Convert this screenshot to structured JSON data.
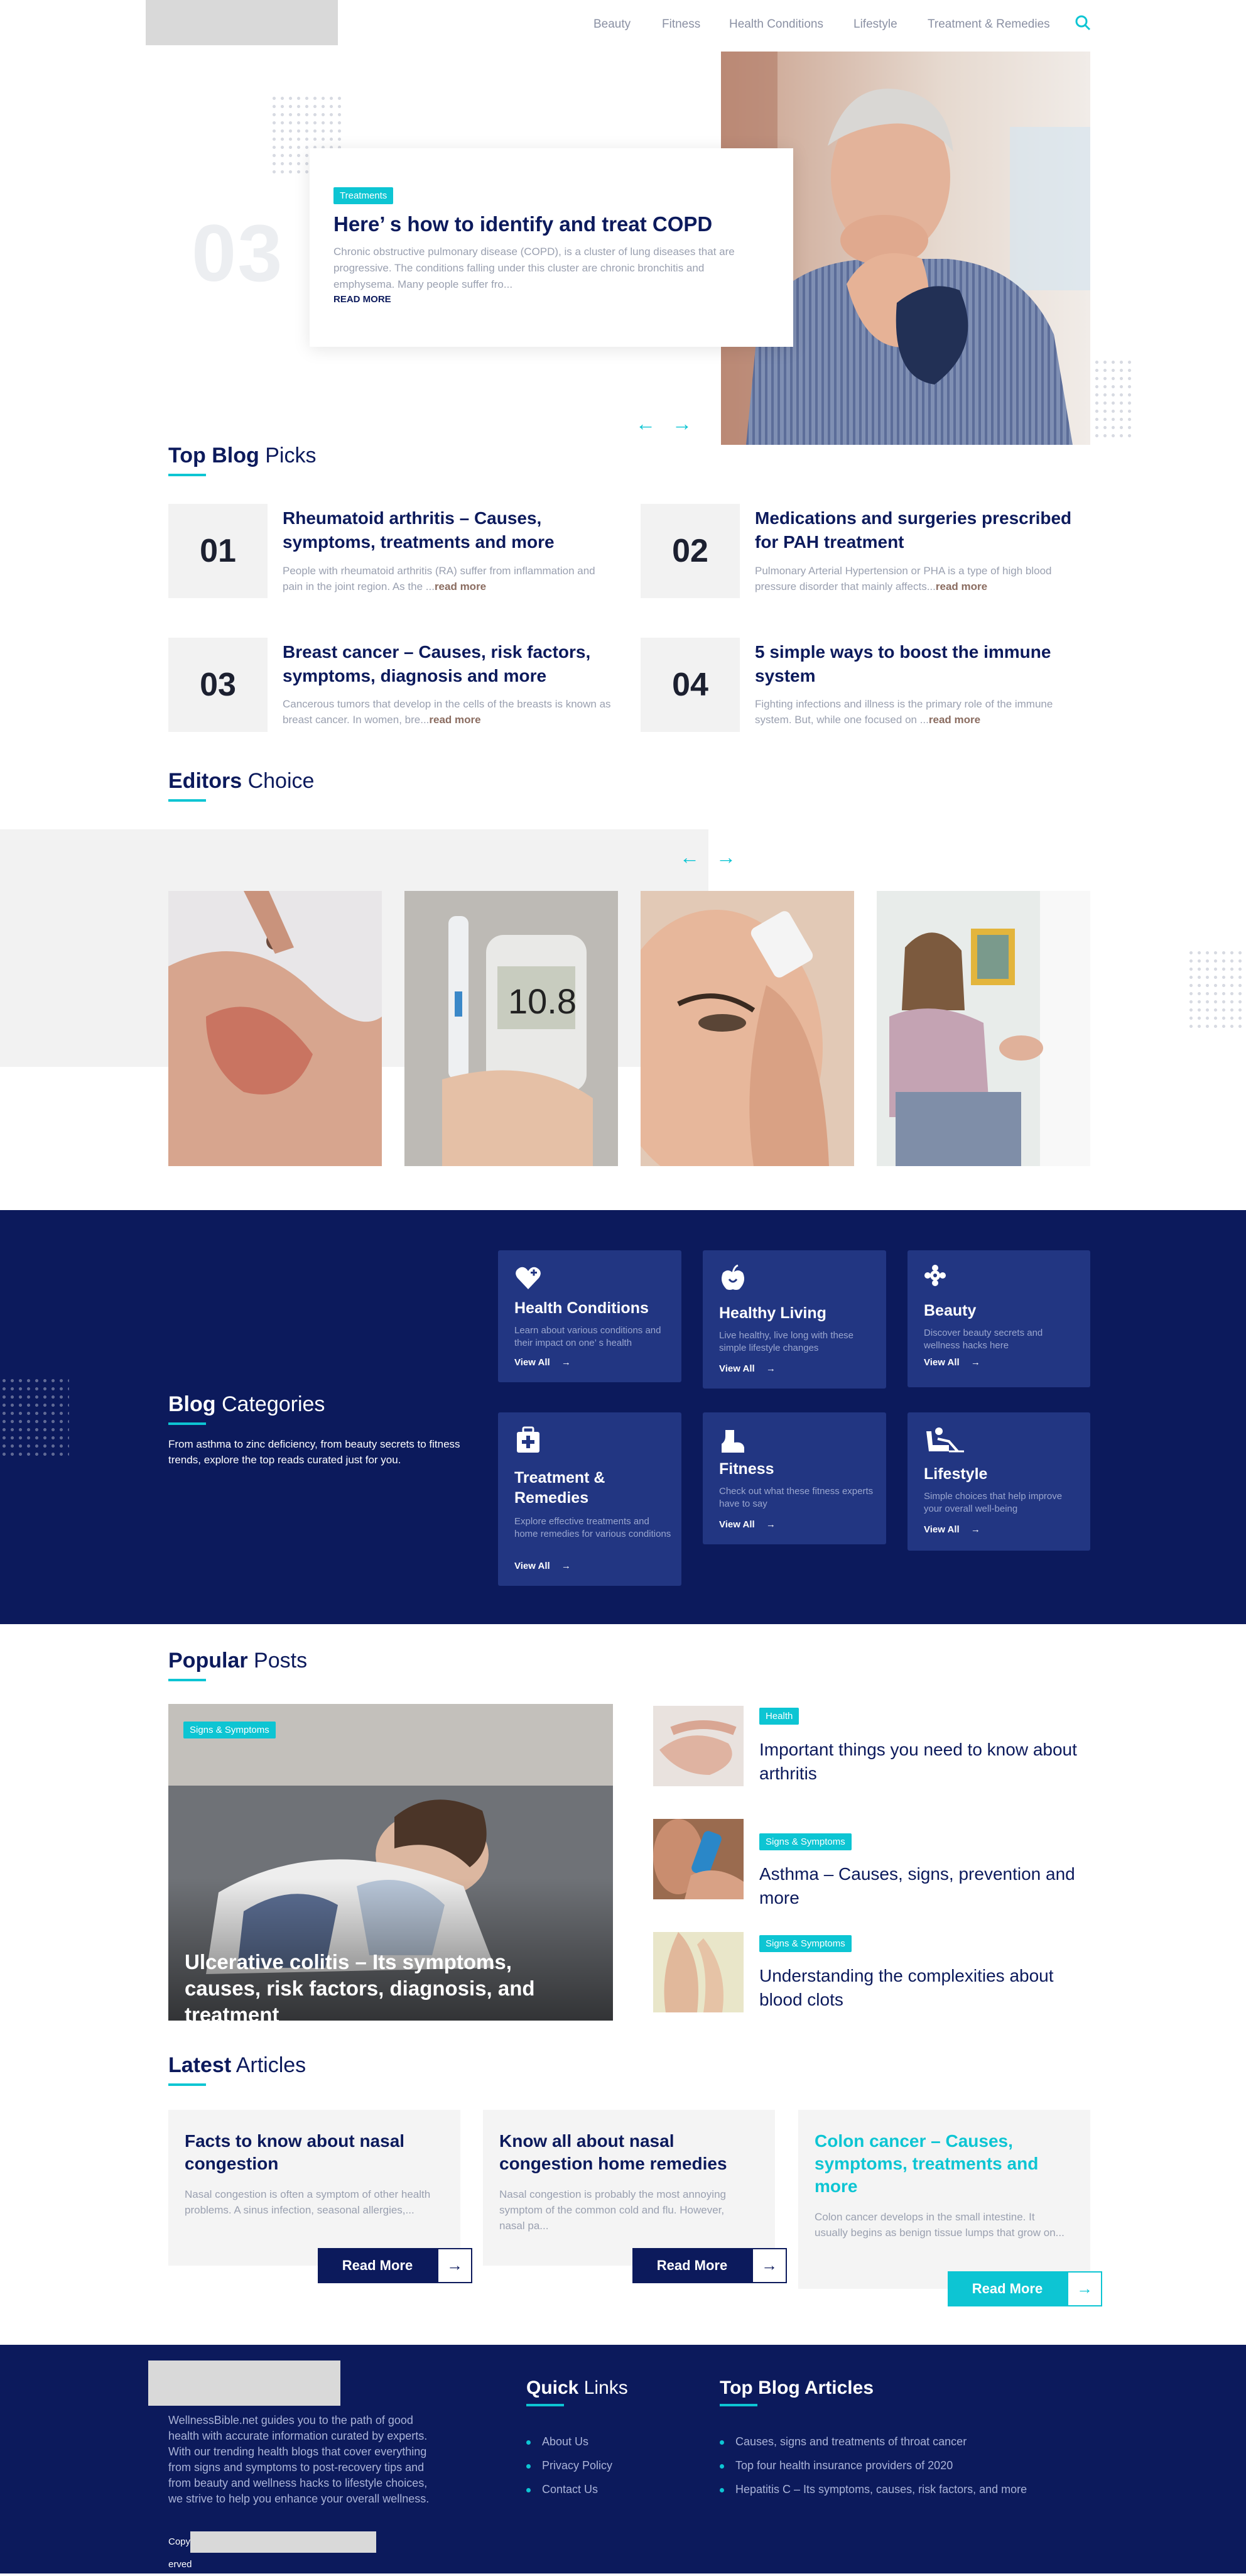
{
  "nav": {
    "items": [
      "Beauty",
      "Fitness",
      "Health Conditions",
      "Lifestyle",
      "Treatment & Remedies"
    ]
  },
  "hero": {
    "number": "03",
    "tag": "Treatments",
    "title": "Here’ s how to identify and treat COPD",
    "description": "Chronic obstructive pulmonary disease (COPD), is a cluster of lung diseases that are progressive. The conditions falling under this cluster are chronic bronchitis and emphysema. Many people suffer fro...",
    "read_more": "READ MORE"
  },
  "top_picks": {
    "heading_bold": "Top Blog",
    "heading_light": "Picks",
    "items": [
      {
        "num": "01",
        "title": "Rheumatoid arthritis – Causes, symptoms, treatments and more",
        "desc": "People with rheumatoid arthritis (RA) suffer from inflammation and pain in the joint region. As the ...",
        "more": "read more"
      },
      {
        "num": "02",
        "title": "Medications and surgeries prescribed for PAH treatment",
        "desc": "Pulmonary Arterial Hypertension or PHA is a type of high blood pressure disorder that mainly affects...",
        "more": "read more"
      },
      {
        "num": "03",
        "title": "Breast cancer – Causes, risk factors, symptoms, diagnosis and more",
        "desc": "Cancerous tumors that develop in the cells of the breasts is known as breast cancer. In women, bre...",
        "more": "read more"
      },
      {
        "num": "04",
        "title": "5 simple ways to boost the immune system",
        "desc": "Fighting infections and illness is the primary role of the immune system. But, while one focused on ...",
        "more": "read more"
      }
    ]
  },
  "editors": {
    "heading_bold": "Editors",
    "heading_light": "Choice"
  },
  "categories": {
    "heading_bold": "Blog",
    "heading_light": "Categories",
    "intro": "From asthma to zinc deficiency, from beauty secrets to fitness trends, explore the top reads curated just for you.",
    "view_all": "View All",
    "items": [
      {
        "title": "Health Conditions",
        "desc": "Learn about various conditions and their impact on one’ s health",
        "icon": "heart-plus-icon"
      },
      {
        "title": "Healthy Living",
        "desc": "Live healthy, live long with these simple lifestyle changes",
        "icon": "apple-icon"
      },
      {
        "title": "Beauty",
        "desc": "Discover beauty secrets and wellness hacks here",
        "icon": "flower-icon"
      },
      {
        "title": "Treatment & Remedies",
        "desc": "Explore effective treatments and home remedies for various conditions",
        "icon": "medkit-icon"
      },
      {
        "title": "Fitness",
        "desc": "Check out what these fitness experts have to say",
        "icon": "boot-icon"
      },
      {
        "title": "Lifestyle",
        "desc": "Simple choices that help improve your overall well-being",
        "icon": "recliner-icon"
      }
    ]
  },
  "popular": {
    "heading_bold": "Popular",
    "heading_light": "Posts",
    "featured": {
      "tag": "Signs & Symptoms",
      "title": "Ulcerative colitis – Its symptoms, causes, risk factors, diagnosis, and treatment"
    },
    "items": [
      {
        "tag": "Health",
        "title": "Important things you need to know about arthritis"
      },
      {
        "tag": "Signs & Symptoms",
        "title": "Asthma – Causes, signs, prevention and more"
      },
      {
        "tag": "Signs & Symptoms",
        "title": "Understanding the complexities about blood clots"
      }
    ]
  },
  "latest": {
    "heading_bold": "Latest",
    "heading_light": "Articles",
    "read_more": "Read More",
    "items": [
      {
        "title": "Facts to know about nasal congestion",
        "desc": "Nasal congestion is often a symptom of other health problems. A sinus infection, seasonal allergies,..."
      },
      {
        "title": "Know all about nasal congestion home remedies",
        "desc": "Nasal congestion is probably the most annoying symptom of the common cold and flu. However, nasal pa..."
      },
      {
        "title": "Colon cancer – Causes, symptoms, treatments and more",
        "desc": "Colon cancer develops in the small intestine. It usually begins as benign tissue lumps that grow on..."
      }
    ]
  },
  "footer": {
    "about": "WellnessBible.net guides you to the path of good health with accurate information curated by experts. With our trending health blogs that cover everything from signs and symptoms to post-recovery tips and from beauty and wellness hacks to lifestyle choices, we strive to help you enhance your overall wellness.",
    "copyright_start": "Copy",
    "copyright_end": "erved",
    "quick_bold": "Quick",
    "quick_light": "Links",
    "quick_links": [
      "About Us",
      "Privacy Policy",
      "Contact Us"
    ],
    "articles_heading": "Top Blog Articles",
    "articles": [
      "Causes, signs and treatments of throat cancer",
      "Top four health insurance providers of 2020",
      "Hepatitis C – Its symptoms, causes, risk factors, and more"
    ]
  },
  "colors": {
    "navy": "#0c1a5c",
    "teal": "#0dc5d3",
    "card_blue": "#223682"
  }
}
